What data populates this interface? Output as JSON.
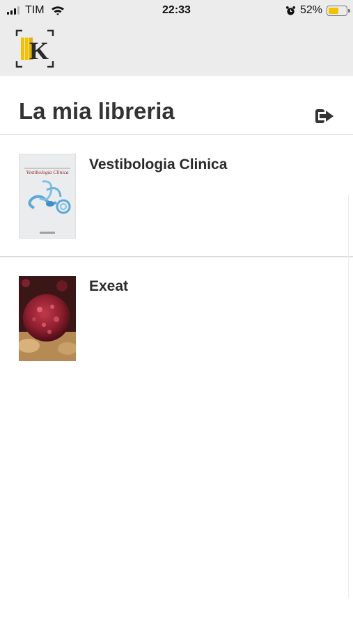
{
  "status_bar": {
    "carrier": "TIM",
    "time": "22:33",
    "battery_percent": "52%",
    "battery_level": 0.52,
    "signal_bars": 3
  },
  "header": {
    "logo_icon": "k-library-logo-icon",
    "colors": {
      "background": "#ececec",
      "logo_accent": "#f2c200"
    }
  },
  "page": {
    "title": "La mia libreria",
    "logout_icon": "logout-icon"
  },
  "books": [
    {
      "title": "Vestibologia Clinica",
      "cover_title": "Vestibologia Clinica"
    },
    {
      "title": "Exeat"
    }
  ]
}
